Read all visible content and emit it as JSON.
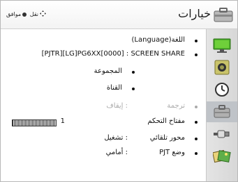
{
  "header": {
    "title": "خيارات",
    "hint_move": "نقل",
    "hint_ok": "موافق"
  },
  "menu": [
    {
      "label": "اللغة(Language)",
      "value": ""
    },
    {
      "label": "",
      "value": "[PJTR][LG]PG6XX[0000] :  SCREEN SHARE"
    },
    {
      "label": "المجموعة",
      "value": ""
    },
    {
      "label": "القناة",
      "value": ""
    },
    {
      "label": "ترجمة",
      "value": ": إيقاف"
    },
    {
      "label": "مفتاح التحكم",
      "value": "1"
    },
    {
      "label": "محور تلقائي",
      "value": ": تشغيل"
    },
    {
      "label": "وضع PJT",
      "value": ": أمامي"
    }
  ],
  "sidebar": {
    "items": [
      {
        "icon": "monitor-icon"
      },
      {
        "icon": "speaker-icon"
      },
      {
        "icon": "clock-icon"
      },
      {
        "icon": "toolbox-icon",
        "selected": true
      },
      {
        "icon": "connector-icon"
      },
      {
        "icon": "media-icon"
      }
    ]
  }
}
